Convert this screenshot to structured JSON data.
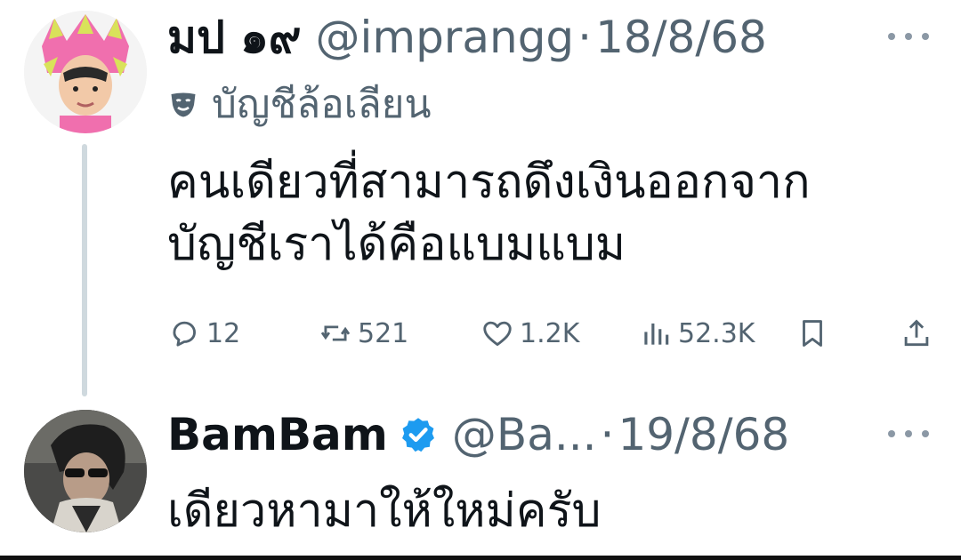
{
  "tweets": [
    {
      "display_name": "มป ๑๙",
      "handle": "@imprangg",
      "separator": "·",
      "date": "18/8/68",
      "label_text": "บัญชีล้อเลียน",
      "body_lines": [
        "คนเดียวที่สามารถดึงเงินออกจาก",
        "บัญชีเราได้คือแบมแบม"
      ],
      "actions": {
        "replies": "12",
        "reposts": "521",
        "likes": "1.2K",
        "views": "52.3K"
      },
      "avatar_colors": {
        "hat": "#f06fae",
        "accent": "#d9e25a"
      }
    },
    {
      "display_name": "BamBam",
      "handle": "@Ba...",
      "separator": "·",
      "date": "19/8/68",
      "body_lines": [
        "เดียวหามาให้ใหม่ครับ"
      ],
      "verified": true
    }
  ],
  "colors": {
    "text": "#0f1419",
    "secondary": "#536471",
    "verified": "#1d9bf0",
    "thread_line": "#cfd9de"
  }
}
